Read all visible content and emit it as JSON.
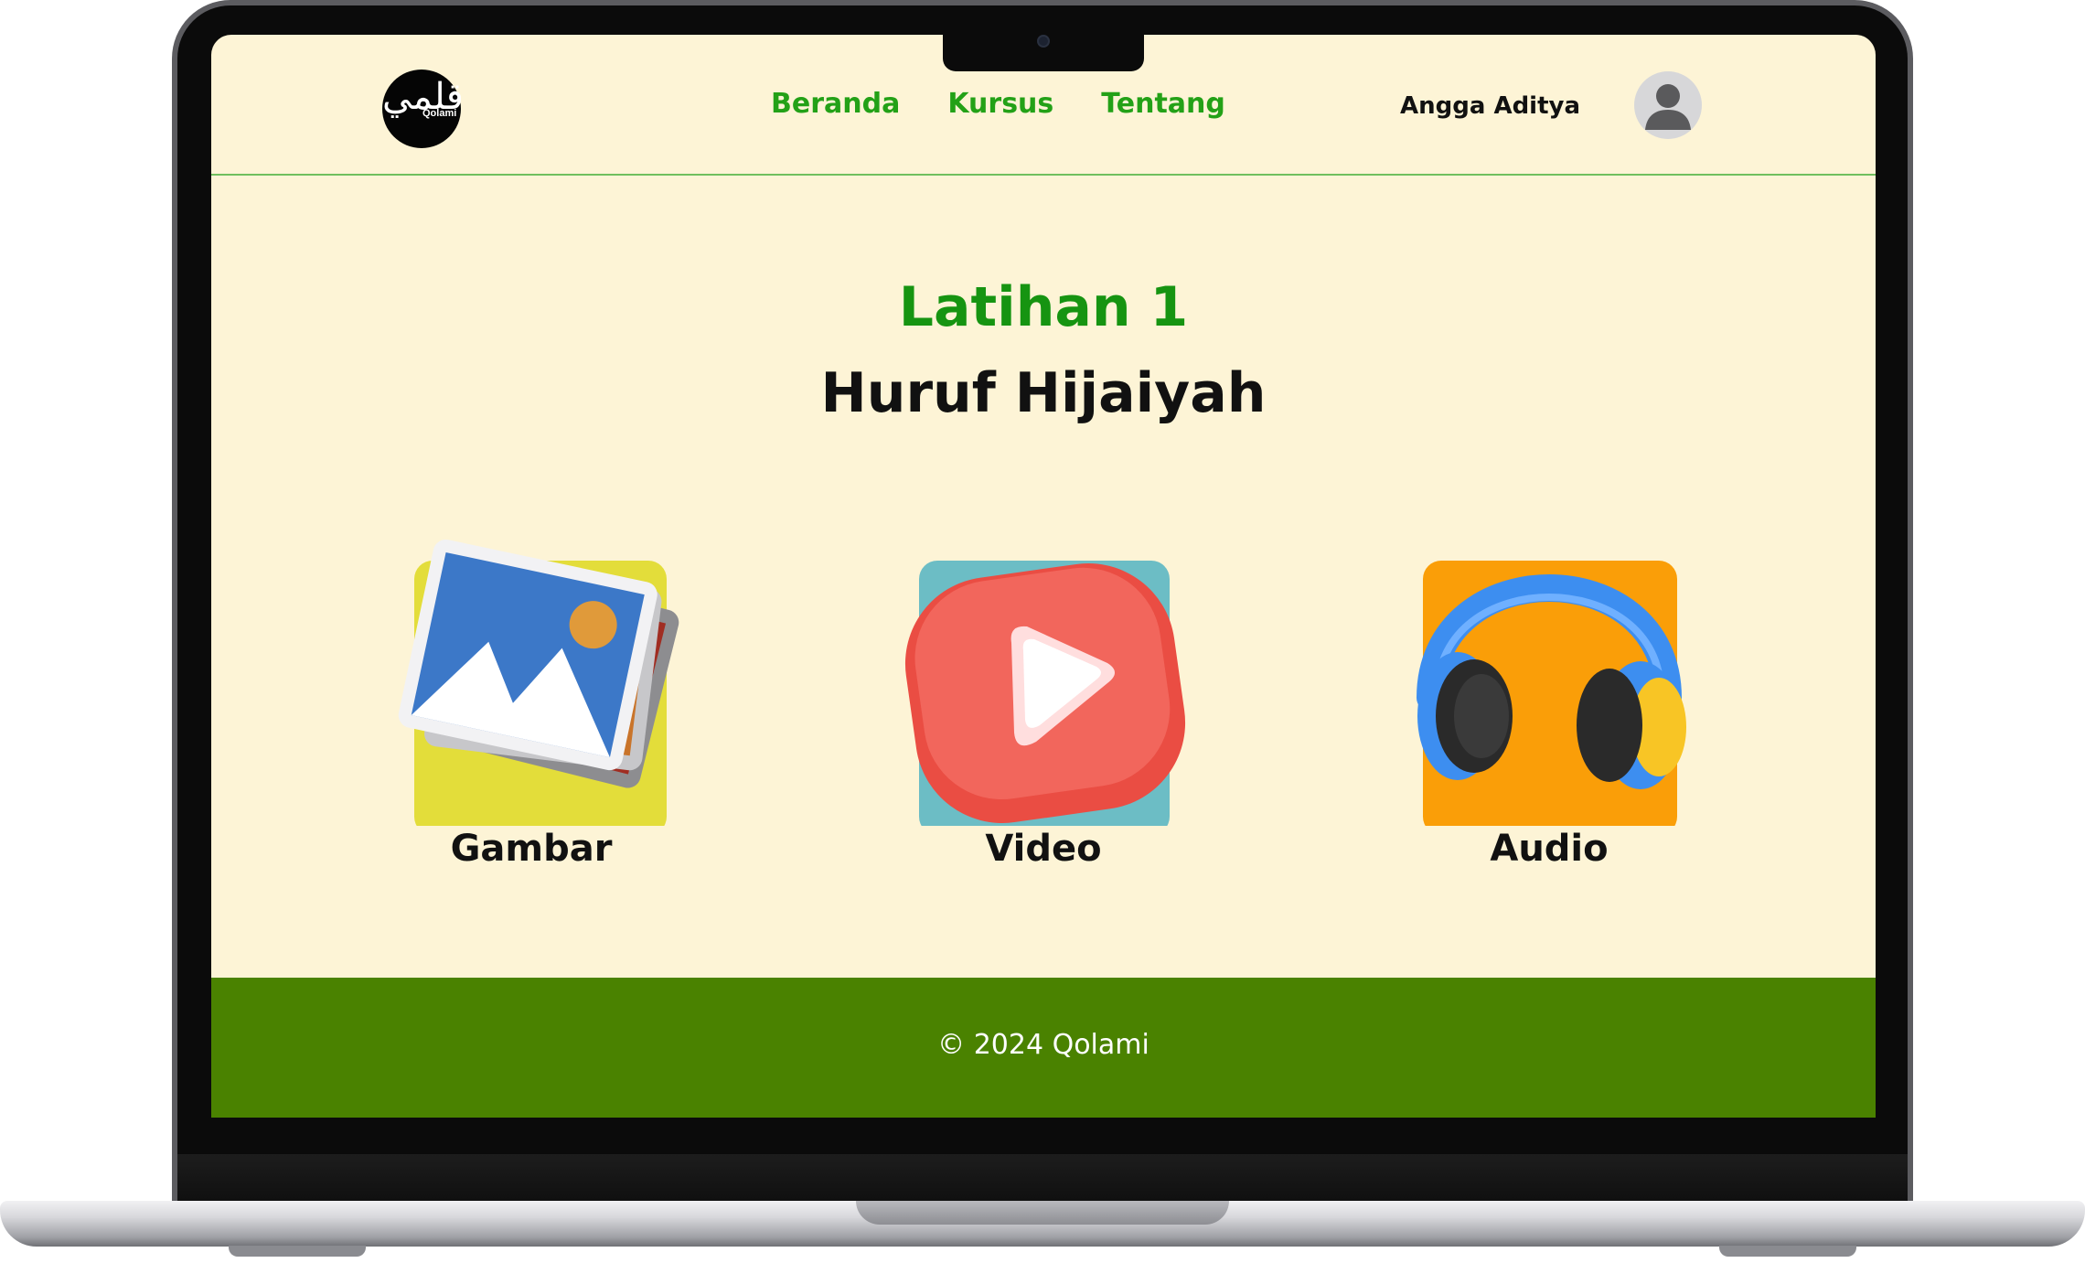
{
  "header": {
    "logo_text": "Qolami",
    "logo_glyph": "قلمي",
    "nav": [
      {
        "label": "Beranda"
      },
      {
        "label": "Kursus"
      },
      {
        "label": "Tentang"
      }
    ],
    "user_name": "Angga Aditya",
    "avatar_icon": "user-avatar-icon"
  },
  "main": {
    "title": "Latihan 1",
    "subtitle": "Huruf Hijaiyah",
    "cards": [
      {
        "label": "Gambar",
        "icon": "image-gallery-icon",
        "bg": "#e3dd3a"
      },
      {
        "label": "Video",
        "icon": "play-button-icon",
        "bg": "#6cbdc5"
      },
      {
        "label": "Audio",
        "icon": "headphones-icon",
        "bg": "#fa9e08"
      }
    ]
  },
  "footer": {
    "copyright": "© 2024 Qolami"
  },
  "colors": {
    "page_bg": "#fdf4d6",
    "nav_green": "#23a117",
    "title_green": "#169411",
    "footer_green": "#4a8200",
    "header_divider": "#6fbf5e"
  }
}
